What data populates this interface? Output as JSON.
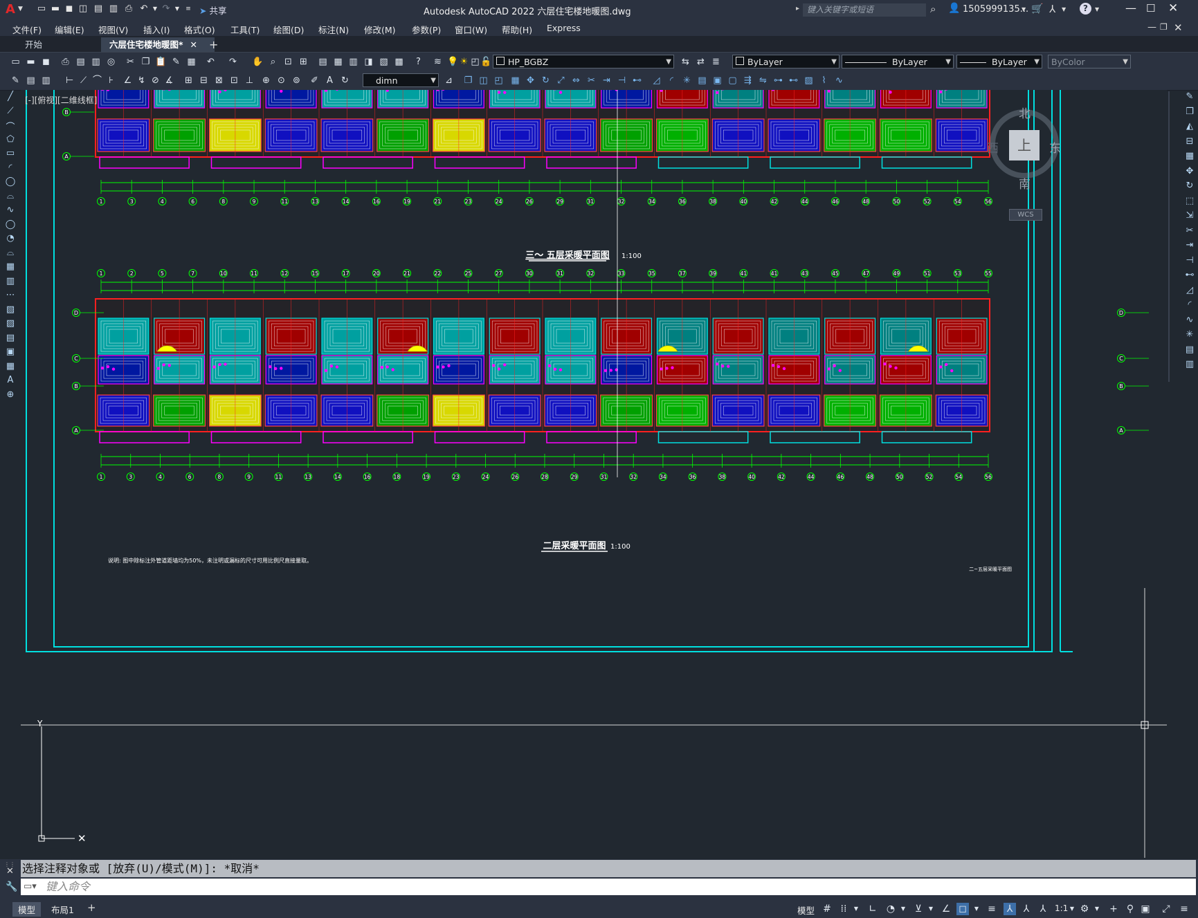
{
  "app": {
    "title": "Autodesk AutoCAD 2022    六层住宅楼地暖图.dwg",
    "logo_letter": "A",
    "share_label": "共享",
    "search_placeholder": "键入关键字或短语",
    "user": "1505999135...",
    "window_controls": [
      "minimize-icon",
      "maximize-icon",
      "close-icon"
    ]
  },
  "menu": [
    "文件(F)",
    "编辑(E)",
    "视图(V)",
    "插入(I)",
    "格式(O)",
    "工具(T)",
    "绘图(D)",
    "标注(N)",
    "修改(M)",
    "参数(P)",
    "窗口(W)",
    "帮助(H)",
    "Express"
  ],
  "tabs": [
    {
      "label": "开始",
      "active": false
    },
    {
      "label": "六层住宅楼地暖图*",
      "active": true
    }
  ],
  "toolbar": {
    "layer": "HP_BGBZ",
    "color": "ByLayer",
    "linetype": "ByLayer",
    "lineweight": "ByLayer",
    "plotstyle": "ByColor",
    "dimstyle": "dimn"
  },
  "viewport": {
    "label": "[-][俯视][二维线框]",
    "viewcube": {
      "north": "北",
      "south": "南",
      "east": "东",
      "west": "西",
      "top": "上",
      "wcs": "WCS"
    },
    "drawing": {
      "upper_title": "三～ 五层采暖平面图",
      "upper_scale": "1:100",
      "lower_title": "二层采暖平面图",
      "lower_scale": "1:100",
      "note": "说明:   图中除标注外管道距墙均为50%，未注明或漏标的尺寸可用比例尺直接量取。",
      "corner_label": "二~五层采暖平面图",
      "axis_rows": [
        "D",
        "C",
        "B",
        "A"
      ],
      "upper_axis_numbers": [
        "1",
        "3",
        "4",
        "6",
        "8",
        "9",
        "11",
        "13",
        "14",
        "16",
        "19",
        "21",
        "23",
        "24",
        "26",
        "29",
        "31",
        "32",
        "34",
        "36",
        "38",
        "40",
        "42",
        "44",
        "46",
        "48",
        "50",
        "52",
        "54",
        "56"
      ],
      "lower_axis_top": [
        "1",
        "2",
        "5",
        "7",
        "10",
        "11",
        "12",
        "15",
        "17",
        "20",
        "21",
        "22",
        "25",
        "27",
        "30",
        "31",
        "32",
        "33",
        "35",
        "37",
        "39",
        "41",
        "41",
        "43",
        "45",
        "47",
        "49",
        "51",
        "53",
        "55"
      ],
      "lower_axis_bottom": [
        "1",
        "3",
        "4",
        "6",
        "8",
        "9",
        "11",
        "13",
        "14",
        "16",
        "18",
        "19",
        "23",
        "24",
        "26",
        "28",
        "29",
        "31",
        "32",
        "34",
        "36",
        "38",
        "40",
        "42",
        "44",
        "46",
        "48",
        "50",
        "52",
        "54",
        "56"
      ]
    }
  },
  "command": {
    "history": "选择注释对象或 [放弃(U)/模式(M)]: *取消*",
    "placeholder": "键入命令"
  },
  "layout_tabs": [
    {
      "label": "模型",
      "active": true
    },
    {
      "label": "布局1",
      "active": false
    }
  ],
  "status": {
    "model_label": "模型",
    "scale": "1:1"
  },
  "colors": {
    "background": "#212830",
    "ui": "#2b3240",
    "cyan": "#00e0e0",
    "green": "#00ff00",
    "red": "#ff2020",
    "magenta": "#ff00ff",
    "yellow": "#ffff00",
    "blue": "#1010c0"
  }
}
